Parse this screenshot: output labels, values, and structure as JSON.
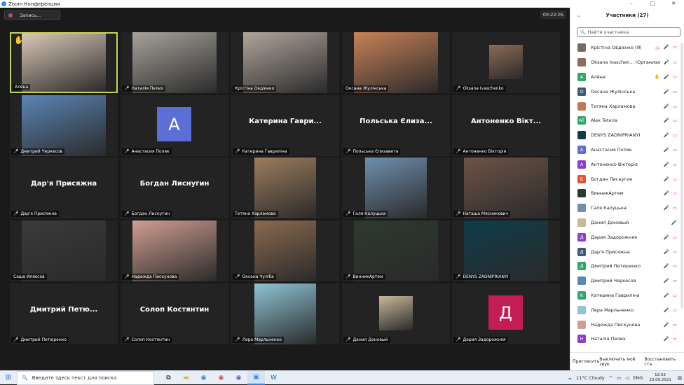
{
  "window": {
    "title": "Zoom Конференция",
    "controls": [
      "–",
      "□",
      "✕"
    ]
  },
  "meeting": {
    "record_label": "Запись...",
    "timer": "00:22:05"
  },
  "tiles": [
    {
      "label": "Алёна",
      "muted": false,
      "type": "photo",
      "bg": "#d9c8b6",
      "active": true,
      "hand": true
    },
    {
      "label": "Наталія Пелих",
      "muted": true,
      "type": "photo",
      "bg": "#a7a39b"
    },
    {
      "label": "Крістіна Овдієнко",
      "muted": false,
      "type": "photo",
      "bg": "#b0a59c"
    },
    {
      "label": "Оксана Жулінська",
      "muted": false,
      "type": "photo",
      "bg": "#c98258"
    },
    {
      "label": "Oksana Ivaschenko",
      "muted": true,
      "type": "small",
      "bg": "#8c6b57"
    },
    {
      "label": "Дмитрий Черкесов",
      "muted": true,
      "type": "photo",
      "bg": "#5b86b5"
    },
    {
      "label": "Анастасия Поляк",
      "muted": true,
      "type": "avatar",
      "letter": "A",
      "color": "#5b6fd6"
    },
    {
      "label": "Катерина Гавриліна",
      "muted": true,
      "type": "name",
      "big": "Катерина Гаври..."
    },
    {
      "label": "Польська Єлизавета",
      "muted": true,
      "type": "name",
      "big": "Польська Єлиза..."
    },
    {
      "label": "Антоненко Вікторія",
      "muted": true,
      "type": "name",
      "big": "Антоненко Вікт..."
    },
    {
      "label": "Дар'я Присяжна",
      "muted": true,
      "type": "name",
      "big": "Дар'я Присяжна"
    },
    {
      "label": "Богдан Лиснугин",
      "muted": true,
      "type": "name",
      "big": "Богдан Лиснугин"
    },
    {
      "label": "Тетяна Харламова",
      "muted": false,
      "type": "half",
      "bg": "#9c7d5e"
    },
    {
      "label": "Галя Калуцька",
      "muted": true,
      "type": "half",
      "bg": "#6f8fae"
    },
    {
      "label": "Наташа Мясникович",
      "muted": true,
      "type": "photo",
      "bg": "#6d5347"
    },
    {
      "label": "Саша Иляєсов",
      "muted": false,
      "type": "photo",
      "bg": "#3a3a3a"
    },
    {
      "label": "Надежда Пискунова",
      "muted": true,
      "type": "photo",
      "bg": "#cf9e92"
    },
    {
      "label": "Оксана Чуліба",
      "muted": true,
      "type": "half",
      "bg": "#8a6a4f"
    },
    {
      "label": "ВинникАртем",
      "muted": true,
      "type": "photo",
      "bg": "#2d3a2e"
    },
    {
      "label": "DENYS ZADNIPRIANYI",
      "muted": true,
      "type": "photo",
      "bg": "#0f3c4a"
    },
    {
      "label": "Дмитрий Петюренко",
      "muted": true,
      "type": "name",
      "big": "Дмитрий Петю..."
    },
    {
      "label": "Солоп Костянтин",
      "muted": true,
      "type": "name",
      "big": "Солоп Костянтин"
    },
    {
      "label": "Лера Марльненко",
      "muted": true,
      "type": "half",
      "bg": "#8fc4d4"
    },
    {
      "label": "Данил Доновый",
      "muted": true,
      "type": "small",
      "bg": "#c8b89a"
    },
    {
      "label": "Дария Задорожняя",
      "muted": true,
      "type": "avatar",
      "letter": "Д",
      "color": "#c21e55"
    }
  ],
  "panel": {
    "title": "Участники (27)",
    "search_placeholder": "Найти участника",
    "participants": [
      {
        "name": "Крістіна Овдієнко (Я)",
        "av": "",
        "color": "#7a6a60",
        "icons": [
          "rec",
          "mic",
          "cam"
        ]
      },
      {
        "name": "Oksana Ivaschen... (Организатор)",
        "av": "",
        "color": "#8c6b57",
        "icons": [
          "mute",
          "cam"
        ]
      },
      {
        "name": "Алёна",
        "av": "A",
        "color": "#2ea86a",
        "icons": [
          "hand",
          "mic",
          "cam"
        ]
      },
      {
        "name": "Оксана Жулінська",
        "av": "O",
        "color": "#3f5a78",
        "icons": [
          "mic",
          "cam"
        ]
      },
      {
        "name": "Тетяна Харламова",
        "av": "",
        "color": "#c07a58",
        "icons": [
          "mic",
          "cam"
        ]
      },
      {
        "name": "Alex Teteria",
        "av": "AT",
        "color": "#2ea86a",
        "icons": [
          "mute",
          "cam"
        ]
      },
      {
        "name": "DENYS ZADNIPRIANYI",
        "av": "",
        "color": "#0f3c4a",
        "icons": [
          "mute",
          "cam"
        ]
      },
      {
        "name": "Анастасия Поляк",
        "av": "A",
        "color": "#5b6fd6",
        "icons": [
          "mute",
          "cam"
        ]
      },
      {
        "name": "Антоненко Вікторія",
        "av": "A",
        "color": "#8a3fd0",
        "icons": [
          "mute",
          "cam"
        ]
      },
      {
        "name": "Богдан Лиснугин",
        "av": "Б",
        "color": "#e0533b",
        "icons": [
          "mute",
          "cam"
        ]
      },
      {
        "name": "ВинникАртем",
        "av": "",
        "color": "#2d3a2e",
        "icons": [
          "mute",
          "cam"
        ]
      },
      {
        "name": "Галя Калуцька",
        "av": "",
        "color": "#6f8fae",
        "icons": [
          "mute",
          "cam"
        ]
      },
      {
        "name": "Данил Доновый",
        "av": "",
        "color": "#c8b89a",
        "icons": [
          "mute"
        ]
      },
      {
        "name": "Дария Задорожняя",
        "av": "Д",
        "color": "#8a3fd0",
        "icons": [
          "mute",
          "cam"
        ]
      },
      {
        "name": "Дар'я Присяжна",
        "av": "Д",
        "color": "#3f5a78",
        "icons": [
          "mute",
          "cam"
        ]
      },
      {
        "name": "Дмитрий Петюренко",
        "av": "Д",
        "color": "#2ea86a",
        "icons": [
          "mute",
          "cam"
        ]
      },
      {
        "name": "Дмитрий Черкесов",
        "av": "",
        "color": "#5b86b5",
        "icons": [
          "mute",
          "cam"
        ]
      },
      {
        "name": "Катерина Гавриліна",
        "av": "K",
        "color": "#2ea86a",
        "icons": [
          "mute",
          "cam"
        ]
      },
      {
        "name": "Лера Марльненко",
        "av": "",
        "color": "#8fc4d4",
        "icons": [
          "mute",
          "cam"
        ]
      },
      {
        "name": "Надежда Пискунова",
        "av": "",
        "color": "#cf9e92",
        "icons": [
          "mute",
          "cam"
        ]
      },
      {
        "name": "Наталія Пелих",
        "av": "H",
        "color": "#8a3fd0",
        "icons": [
          "mute",
          "cam"
        ]
      }
    ],
    "footer": {
      "invite": "Пригласить",
      "mute_all": "Выключить мой звук",
      "restore": "Восстановить ста"
    }
  },
  "taskbar": {
    "search_placeholder": "Введите здесь текст для поиска",
    "weather": "11°C  Cloudy",
    "lang": "ENG",
    "time": "12:52",
    "date": "23.09.2021"
  }
}
